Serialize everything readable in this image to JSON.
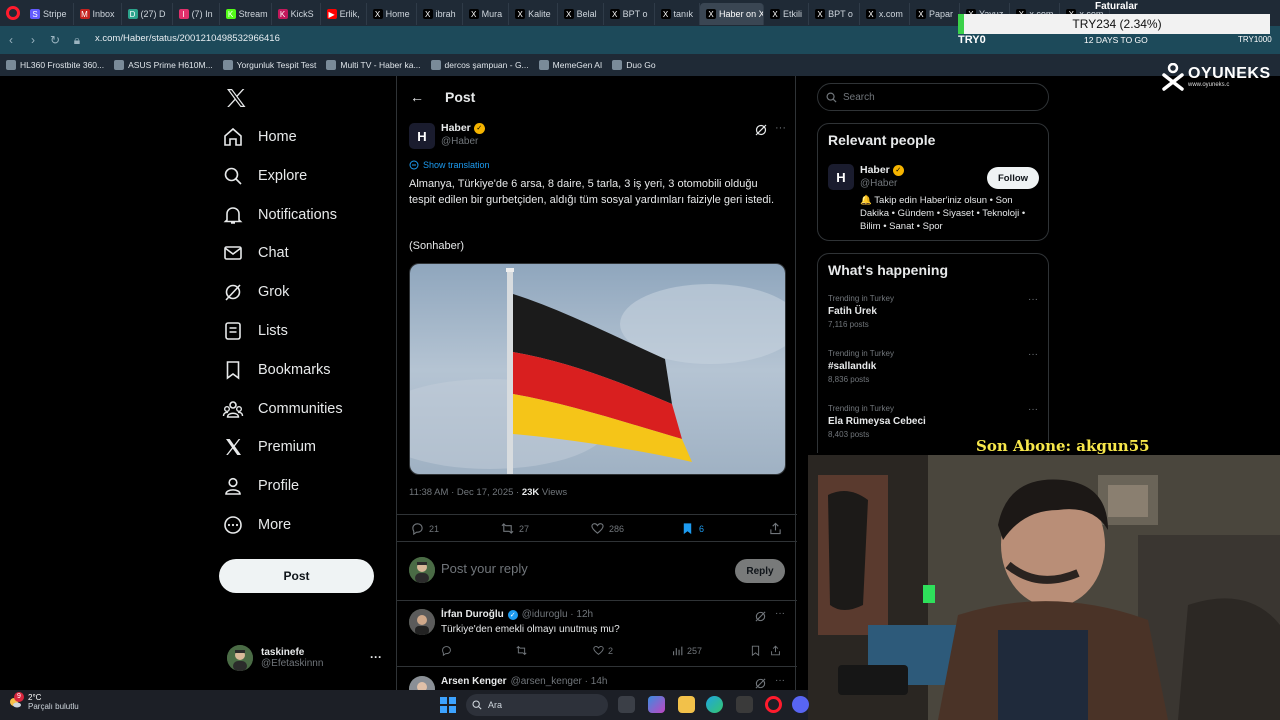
{
  "browser": {
    "tabs": [
      {
        "label": "Stripe",
        "color": "#635bff",
        "glyph": "S"
      },
      {
        "label": "Inbox",
        "color": "#c5221f",
        "glyph": "M"
      },
      {
        "label": "(27) D",
        "color": "#2ba38c",
        "glyph": "D"
      },
      {
        "label": "(7) In",
        "color": "#e1306c",
        "glyph": "I"
      },
      {
        "label": "Stream",
        "color": "#53fc18",
        "glyph": "K"
      },
      {
        "label": "KickS",
        "color": "#c2185b",
        "glyph": "K"
      },
      {
        "label": "Erlik,",
        "color": "#ff0000",
        "glyph": "▶"
      },
      {
        "label": "Home",
        "color": "#000000",
        "glyph": "X"
      },
      {
        "label": "ibrah",
        "color": "#000000",
        "glyph": "X"
      },
      {
        "label": "Mura",
        "color": "#000000",
        "glyph": "X"
      },
      {
        "label": "Kalite",
        "color": "#000000",
        "glyph": "X"
      },
      {
        "label": "Belal",
        "color": "#000000",
        "glyph": "X"
      },
      {
        "label": "BPT o",
        "color": "#000000",
        "glyph": "X"
      },
      {
        "label": "tanık",
        "color": "#000000",
        "glyph": "X"
      },
      {
        "label": "Haber on X",
        "color": "#000000",
        "glyph": "X",
        "active": true
      },
      {
        "label": "Etkili",
        "color": "#000000",
        "glyph": "X"
      },
      {
        "label": "BPT o",
        "color": "#000000",
        "glyph": "X"
      },
      {
        "label": "x.com",
        "color": "#000000",
        "glyph": "X"
      },
      {
        "label": "Papar",
        "color": "#000000",
        "glyph": "X"
      },
      {
        "label": "Yavuz",
        "color": "#000000",
        "glyph": "X"
      },
      {
        "label": "x.com",
        "color": "#000000",
        "glyph": "X"
      },
      {
        "label": "x.com",
        "color": "#000000",
        "glyph": "X"
      }
    ],
    "url": "x.com/Haber/status/2001210498532966416",
    "bookmarks": [
      {
        "label": "HL360 Frostbite 360..."
      },
      {
        "label": "ASUS Prime H610M..."
      },
      {
        "label": "Yorgunluk Tespit Test"
      },
      {
        "label": "Multi TV - Haber ka..."
      },
      {
        "label": "dercos şampuan - G..."
      },
      {
        "label": "MemeGen AI"
      },
      {
        "label": "Duo Go"
      }
    ]
  },
  "overlay": {
    "ticker_head": "Faturalar",
    "ticker_value": "TRY234 (2.34%)",
    "try_label": "TRY0",
    "date_label": "12 DAYS TO GO",
    "try_right": "TRY1000",
    "brand": "OYUNEKS",
    "brand_sub": "www.oyuneks.c",
    "son_abone": "Son Abone: akgun55"
  },
  "nav": {
    "items": [
      {
        "label": "Home",
        "icon": "home-icon"
      },
      {
        "label": "Explore",
        "icon": "search-icon"
      },
      {
        "label": "Notifications",
        "icon": "bell-icon"
      },
      {
        "label": "Chat",
        "icon": "mail-icon"
      },
      {
        "label": "Grok",
        "icon": "grok-icon"
      },
      {
        "label": "Lists",
        "icon": "list-icon"
      },
      {
        "label": "Bookmarks",
        "icon": "bookmark-icon"
      },
      {
        "label": "Communities",
        "icon": "communities-icon"
      },
      {
        "label": "Premium",
        "icon": "x-icon"
      },
      {
        "label": "Profile",
        "icon": "profile-icon"
      },
      {
        "label": "More",
        "icon": "more-icon"
      }
    ],
    "post_button": "Post",
    "account_name": "taskinefe",
    "account_handle": "@Efetaskinnn"
  },
  "post": {
    "header": "Post",
    "author_initial": "H",
    "author_name": "Haber",
    "author_handle": "@Haber",
    "show_translation": "Show translation",
    "text": "Almanya, Türkiye'de 6 arsa, 8 daire, 5 tarla, 3 iş yeri, 3 otomobili olduğu tespit edilen bir gurbetçiden, aldığı tüm sosyal yardımları faiziyle geri istedi.",
    "source": "(Sonhaber)",
    "time": "11:38 AM · Dec 17, 2025 · ",
    "views_count": "23K",
    "views_label": " Views",
    "replies": "21",
    "reposts": "27",
    "likes": "286",
    "bookmarks": "6",
    "reply_placeholder": "Post your reply",
    "reply_button": "Reply"
  },
  "comments": [
    {
      "name": "İrfan Duroğlu",
      "handle": "@iduroglu · 12h",
      "text": "Türkiye'den emekli olmayı unutmuş mu?",
      "replies": "",
      "reposts": "",
      "likes": "2",
      "views": "257"
    },
    {
      "name": "Arsen Kenger",
      "handle": "@arsen_kenger · 14h",
      "text": ""
    }
  ],
  "right": {
    "search_placeholder": "Search",
    "relevant_title": "Relevant people",
    "rp_name": "Haber",
    "rp_handle": "@Haber",
    "follow": "Follow",
    "rp_bio": "🔔 Takip edin Haber'iniz olsun • Son Dakika • Gündem • Siyaset • Teknoloji • Bilim • Sanat • Spor",
    "happening_title": "What's happening",
    "trends": [
      {
        "context": "Trending in Turkey",
        "title": "Fatih Ürek",
        "count": "7,116 posts"
      },
      {
        "context": "Trending in Turkey",
        "title": "#sallandık",
        "count": "8,836 posts"
      },
      {
        "context": "Trending in Turkey",
        "title": "Ela Rümeysa Cebeci",
        "count": "8,403 posts"
      }
    ]
  },
  "taskbar": {
    "notif_count": "9",
    "temp": "2°C",
    "condition": "Parçalı bulutlu",
    "search_label": "Ara"
  }
}
